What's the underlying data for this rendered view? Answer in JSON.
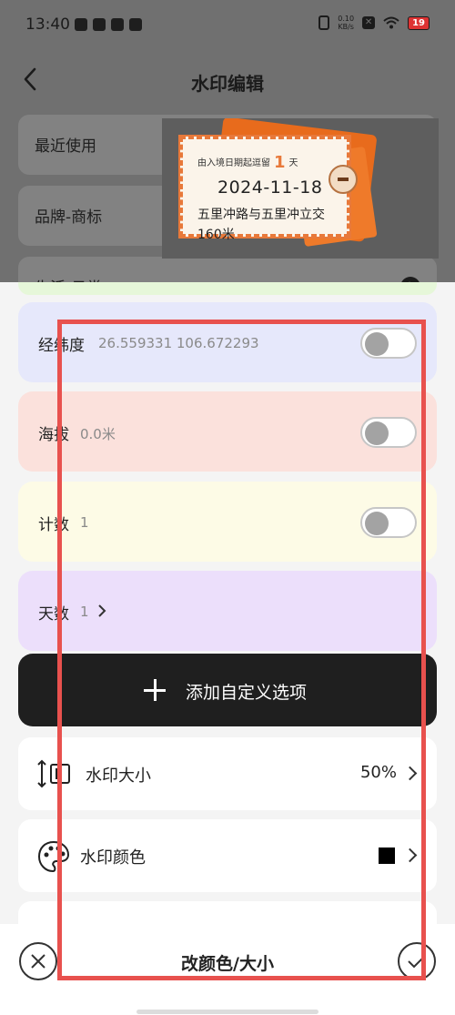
{
  "status_bar": {
    "time": "13:40",
    "network_speed": "0.10\nKB/s",
    "battery": "19"
  },
  "header": {
    "title": "水印编辑"
  },
  "background_categories": [
    "最近使用",
    "品牌-商标",
    "生活-日常"
  ],
  "preview": {
    "entry_prefix": "由入境日期起逗留",
    "entry_days": "1",
    "entry_suffix": "天",
    "date": "2024-11-18",
    "location": "五里冲路与五里冲立交",
    "altitude": "160米"
  },
  "options": [
    {
      "label": "经纬度",
      "value": "26.559331  106.672293",
      "color": "#e6e8fb",
      "toggle_on": false
    },
    {
      "label": "海拔",
      "value": "0.0米",
      "color": "#fbe1dc",
      "toggle_on": false
    },
    {
      "label": "计数",
      "value": "1",
      "color": "#fdfbe6",
      "toggle_on": false
    },
    {
      "label": "天数",
      "value": "1",
      "color": "#ecdffb",
      "has_arrow": true
    }
  ],
  "add_custom": {
    "label": "添加自定义选项"
  },
  "settings": {
    "size": {
      "label": "水印大小",
      "value": "50%"
    },
    "color": {
      "label": "水印颜色",
      "value_color": "#000000"
    }
  },
  "bottom_bar": {
    "title": "改颜色/大小"
  },
  "highlight_color": "#e8514e"
}
